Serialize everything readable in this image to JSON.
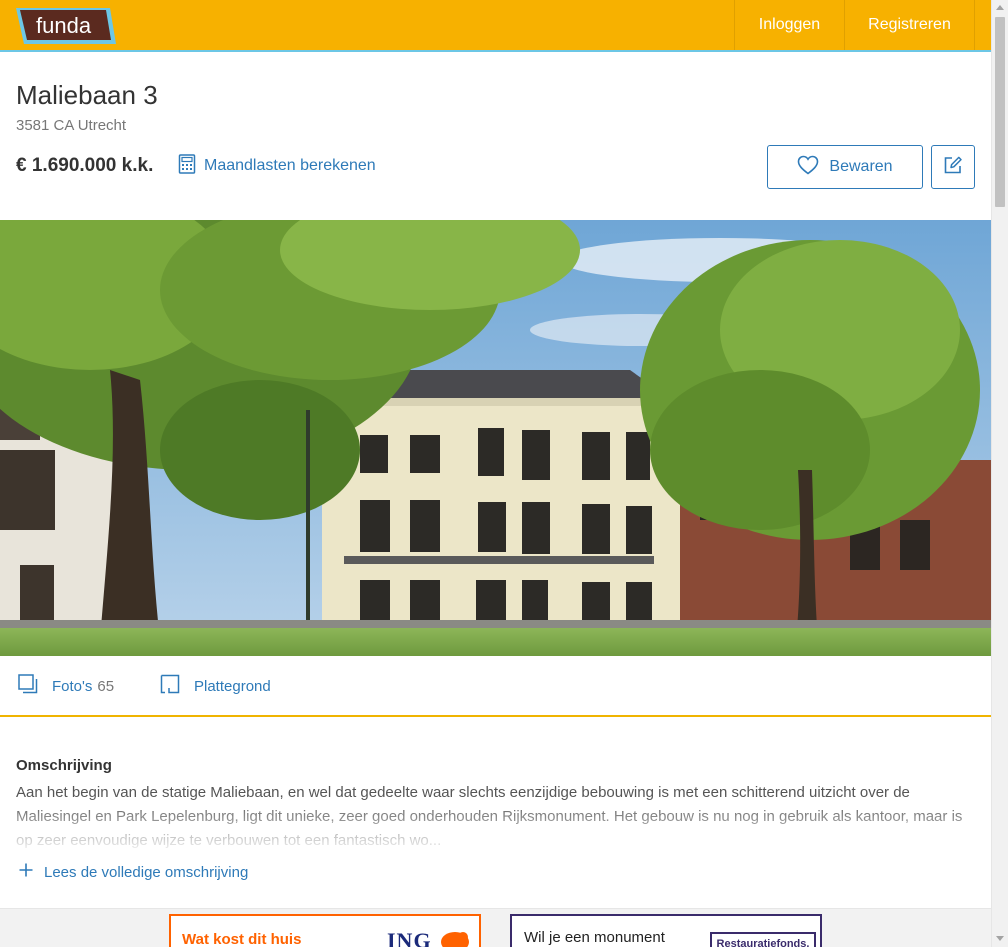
{
  "header": {
    "logo_text": "funda",
    "login_label": "Inloggen",
    "register_label": "Registreren",
    "brand_color": "#f7b100",
    "accent_line_color": "#6cc7e6"
  },
  "listing": {
    "title": "Maliebaan 3",
    "postal_city": "3581 CA Utrecht",
    "price": "€ 1.690.000 k.k.",
    "mortgage_link": "Maandlasten berekenen",
    "save_label": "Bewaren"
  },
  "media": {
    "photos_label": "Foto's",
    "photos_count": "65",
    "floorplan_label": "Plattegrond"
  },
  "description": {
    "heading": "Omschrijving",
    "text": "Aan het begin van de statige Maliebaan, en wel dat gedeelte waar slechts eenzijdige bebouwing is met een schitterend uitzicht over de Maliesingel en Park Lepelenburg, ligt dit unieke, zeer goed onderhouden Rijksmonument. Het gebouw is nu nog in gebruik als kantoor, maar is op zeer eenvoudige wijze te verbouwen tot een fantastisch wo...",
    "read_more": "Lees de volledige omschrijving"
  },
  "ads": {
    "ing_text": "Wat kost dit huis",
    "ing_brand": "ING",
    "monument_text": "Wil je een monument",
    "monument_brand": "Restauratiefonds."
  },
  "colors": {
    "link": "#2e7ab8",
    "divider": "#f0b400",
    "ing_orange": "#ff6200"
  }
}
